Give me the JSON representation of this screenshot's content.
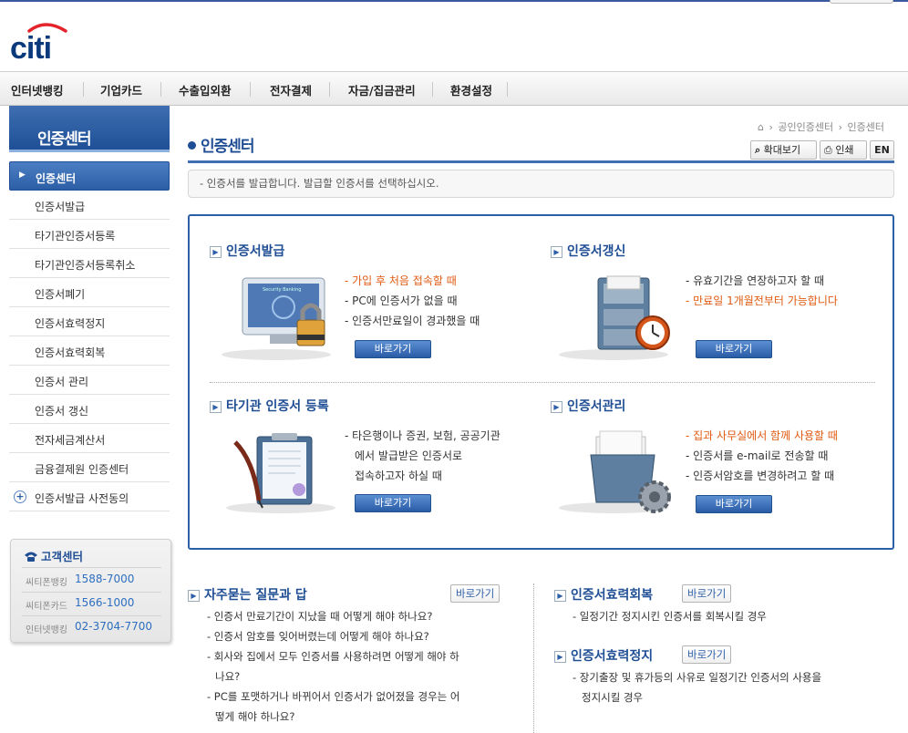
{
  "brand": {
    "logo": "citi"
  },
  "gnb": [
    "인터넷뱅킹",
    "기업카드",
    "수출입외환",
    "전자결제",
    "자금/집금관리",
    "환경설정"
  ],
  "lnb": {
    "title": "인증센터",
    "items": [
      {
        "label": "인증서발급"
      },
      {
        "label": "타기관인증서등록"
      },
      {
        "label": "타기관인증서등록취소"
      },
      {
        "label": "인증서폐기"
      },
      {
        "label": "인증서효력정지"
      },
      {
        "label": "인증서효력회복"
      },
      {
        "label": "인증서 관리"
      },
      {
        "label": "인증서 갱신"
      },
      {
        "label": "전자세금계산서"
      },
      {
        "label": "금융결제원 인증센터"
      },
      {
        "label": "인증서발급 사전동의"
      }
    ],
    "active": "인증센터"
  },
  "customer_center": {
    "title": "고객센터",
    "rows": [
      {
        "label": "씨티폰뱅킹",
        "phone": "1588-7000"
      },
      {
        "label": "씨티폰카드",
        "phone": "1566-1000"
      },
      {
        "label": "인터넷뱅킹",
        "phone": "02-3704-7700"
      }
    ]
  },
  "breadcrumb": {
    "items": [
      "공인인증센터",
      "인증센터"
    ]
  },
  "page": {
    "title": "인증센터",
    "tools": {
      "zoom": "확대보기",
      "print": "인쇄",
      "lang": "EN"
    },
    "notice": "- 인증서를 발급합니다. 발급할 인증서를 선택하십시오."
  },
  "sections": {
    "issue": {
      "title": "인증서발급",
      "lines": [
        "- 가입 후 처음 접속할 때",
        "- PC에 인증서가 없을 때",
        "- 인증서만료일이 경과했을 때"
      ],
      "button": "바로가기"
    },
    "renew": {
      "title": "인증서갱신",
      "lines": [
        "- 유효기간을 연장하고자 할 때",
        "- 만료일 1개월전부터 가능합니다"
      ],
      "button": "바로가기"
    },
    "other": {
      "title": "타기관 인증서 등록",
      "lines": [
        "- 타은행이나 증권, 보험, 공공기관",
        "에서 발급받은 인증서로",
        "접속하고자 하실 때"
      ],
      "button": "바로가기"
    },
    "manage": {
      "title": "인증서관리",
      "lines": [
        "- 집과 사무실에서 함께 사용할 때",
        "- 인증서를 e-mail로 전송할 때",
        "- 인증서암호를 변경하려고 할 때"
      ],
      "button": "바로가기"
    }
  },
  "accent_colors": {
    "orange": "#e05a12",
    "navy": "#1f4e94"
  },
  "faq": {
    "title": "자주묻는 질문과 답",
    "button": "바로가기",
    "items": [
      "- 인증서 만료기간이 지났을 때 어떻게 해야 하나요?",
      "- 인증서 암호를 잊어버렸는데 어떻게 해야 하나요?",
      "- 회사와 집에서 모두 인증서를 사용하려면 어떻게 해야 하",
      "나요?",
      "- PC를 포맷하거나 바뀌어서 인증서가 없어졌을 경우는 어",
      "떻게 해야 하나요?"
    ]
  },
  "side_links": [
    {
      "title": "인증서효력회복",
      "button": "바로가기",
      "lines": [
        "- 일정기간 정지시킨 인증서를 회복시킬 경우"
      ]
    },
    {
      "title": "인증서효력정지",
      "button": "바로가기",
      "lines": [
        "- 장기출장 및 휴가등의 사유로 일정기간 인증서의 사용을",
        "정지시킬 경우"
      ]
    }
  ]
}
